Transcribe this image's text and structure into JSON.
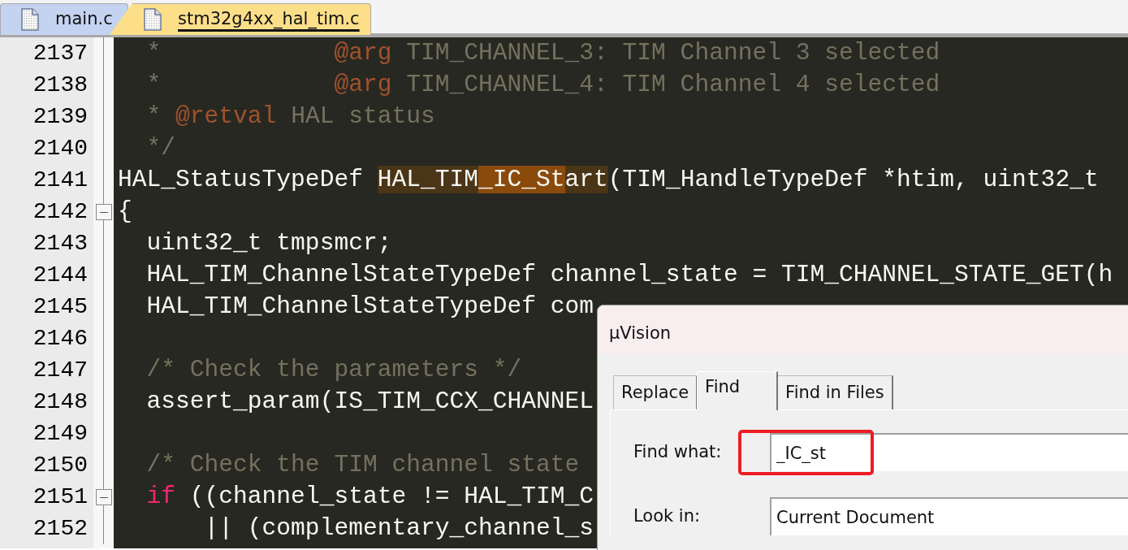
{
  "tabs": [
    {
      "label": "main.c",
      "selected": false
    },
    {
      "label": "stm32g4xx_hal_tim.c",
      "selected": true
    }
  ],
  "editor": {
    "lines": [
      {
        "number": "2137",
        "collapsible": false,
        "tokens": [
          {
            "kind": "comment",
            "text": "  *            "
          },
          {
            "kind": "doc-tag",
            "text": "@arg"
          },
          {
            "kind": "comment",
            "text": " TIM_CHANNEL_3: TIM Channel 3 selected"
          }
        ]
      },
      {
        "number": "2138",
        "collapsible": false,
        "tokens": [
          {
            "kind": "comment",
            "text": "  *            "
          },
          {
            "kind": "doc-tag",
            "text": "@arg"
          },
          {
            "kind": "comment",
            "text": " TIM_CHANNEL_4: TIM Channel 4 selected"
          }
        ]
      },
      {
        "number": "2139",
        "collapsible": false,
        "tokens": [
          {
            "kind": "comment",
            "text": "  * "
          },
          {
            "kind": "doc-tag",
            "text": "@retval"
          },
          {
            "kind": "comment",
            "text": " HAL status"
          }
        ]
      },
      {
        "number": "2140",
        "collapsible": false,
        "tokens": [
          {
            "kind": "comment",
            "text": "  */"
          }
        ]
      },
      {
        "number": "2141",
        "collapsible": false,
        "tokens": [
          {
            "kind": "plain",
            "text": "HAL_StatusTypeDef "
          },
          {
            "kind": "match-dim",
            "text": "HAL_TIM"
          },
          {
            "kind": "match",
            "text": "_IC_St"
          },
          {
            "kind": "match-dim",
            "text": "art"
          },
          {
            "kind": "plain",
            "text": "(TIM_HandleTypeDef *htim, uint32_t"
          }
        ]
      },
      {
        "number": "2142",
        "collapsible": true,
        "tokens": [
          {
            "kind": "plain",
            "text": "{"
          }
        ]
      },
      {
        "number": "2143",
        "collapsible": false,
        "tokens": [
          {
            "kind": "plain",
            "text": "  uint32_t tmpsmcr;"
          }
        ]
      },
      {
        "number": "2144",
        "collapsible": false,
        "tokens": [
          {
            "kind": "plain",
            "text": "  HAL_TIM_ChannelStateTypeDef channel_state = TIM_CHANNEL_STATE_GET(h"
          }
        ]
      },
      {
        "number": "2145",
        "collapsible": false,
        "tokens": [
          {
            "kind": "plain",
            "text": "  HAL_TIM_ChannelStateTypeDef com"
          }
        ]
      },
      {
        "number": "2146",
        "collapsible": false
      },
      {
        "number": "2147",
        "collapsible": false,
        "tokens": [
          {
            "kind": "comment",
            "text": "  /* Check the parameters */"
          }
        ]
      },
      {
        "number": "2148",
        "collapsible": false,
        "tokens": [
          {
            "kind": "plain",
            "text": "  assert_param(IS_TIM_CCX_CHANNEL"
          }
        ]
      },
      {
        "number": "2149",
        "collapsible": false
      },
      {
        "number": "2150",
        "collapsible": false,
        "tokens": [
          {
            "kind": "comment",
            "text": "  /* Check the TIM channel state"
          }
        ]
      },
      {
        "number": "2151",
        "collapsible": true,
        "tokens": [
          {
            "kind": "keyword",
            "text": "  if"
          },
          {
            "kind": "plain",
            "text": " ((channel_state != HAL_TIM_C"
          }
        ]
      },
      {
        "number": "2152",
        "collapsible": false,
        "tokens": [
          {
            "kind": "plain",
            "text": "      || (complementary_channel_s"
          }
        ]
      }
    ]
  },
  "dialog": {
    "title": "µVision",
    "tabs": [
      {
        "label": "Replace",
        "selected": false
      },
      {
        "label": "Find",
        "selected": true
      },
      {
        "label": "Find in Files",
        "selected": false
      }
    ],
    "fields": [
      {
        "label": "Find what:",
        "value": "_IC_st",
        "highlighted": true
      },
      {
        "label": "Look in:",
        "value": "Current Document",
        "highlighted": false
      }
    ]
  }
}
